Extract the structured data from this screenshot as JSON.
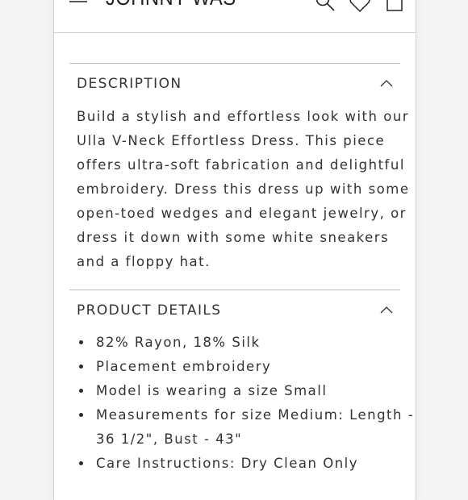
{
  "header": {
    "brand": "JOHNNY WAS",
    "icons": [
      "menu-icon",
      "search-icon",
      "heart-icon",
      "shopping-bag-icon"
    ]
  },
  "description": {
    "title": "DESCRIPTION",
    "expanded": true,
    "lines": [
      "Build a stylish and effortless look with our",
      "Ulla V-Neck Effortless Dress. This piece",
      "offers ultra-soft fabrication and delightful",
      "embroidery. Dress this dress up with some",
      "open-toed wedges and elegant jewelry, or",
      "dress it down with some white sneakers",
      "and a floppy hat."
    ]
  },
  "product_details": {
    "title": "PRODUCT DETAILS",
    "expanded": true,
    "items": [
      "82% Rayon, 18% Silk",
      "Placement embroidery",
      "Model is wearing a size Small",
      "Measurements for size Medium: Length -",
      "36 1/2\", Bust - 43\"",
      "Care Instructions: Dry Clean Only"
    ]
  },
  "colors": {
    "text": "#333333",
    "divider": "#bdbdbd",
    "background": "#ffffff",
    "page_margin": "#f4f4f4"
  }
}
